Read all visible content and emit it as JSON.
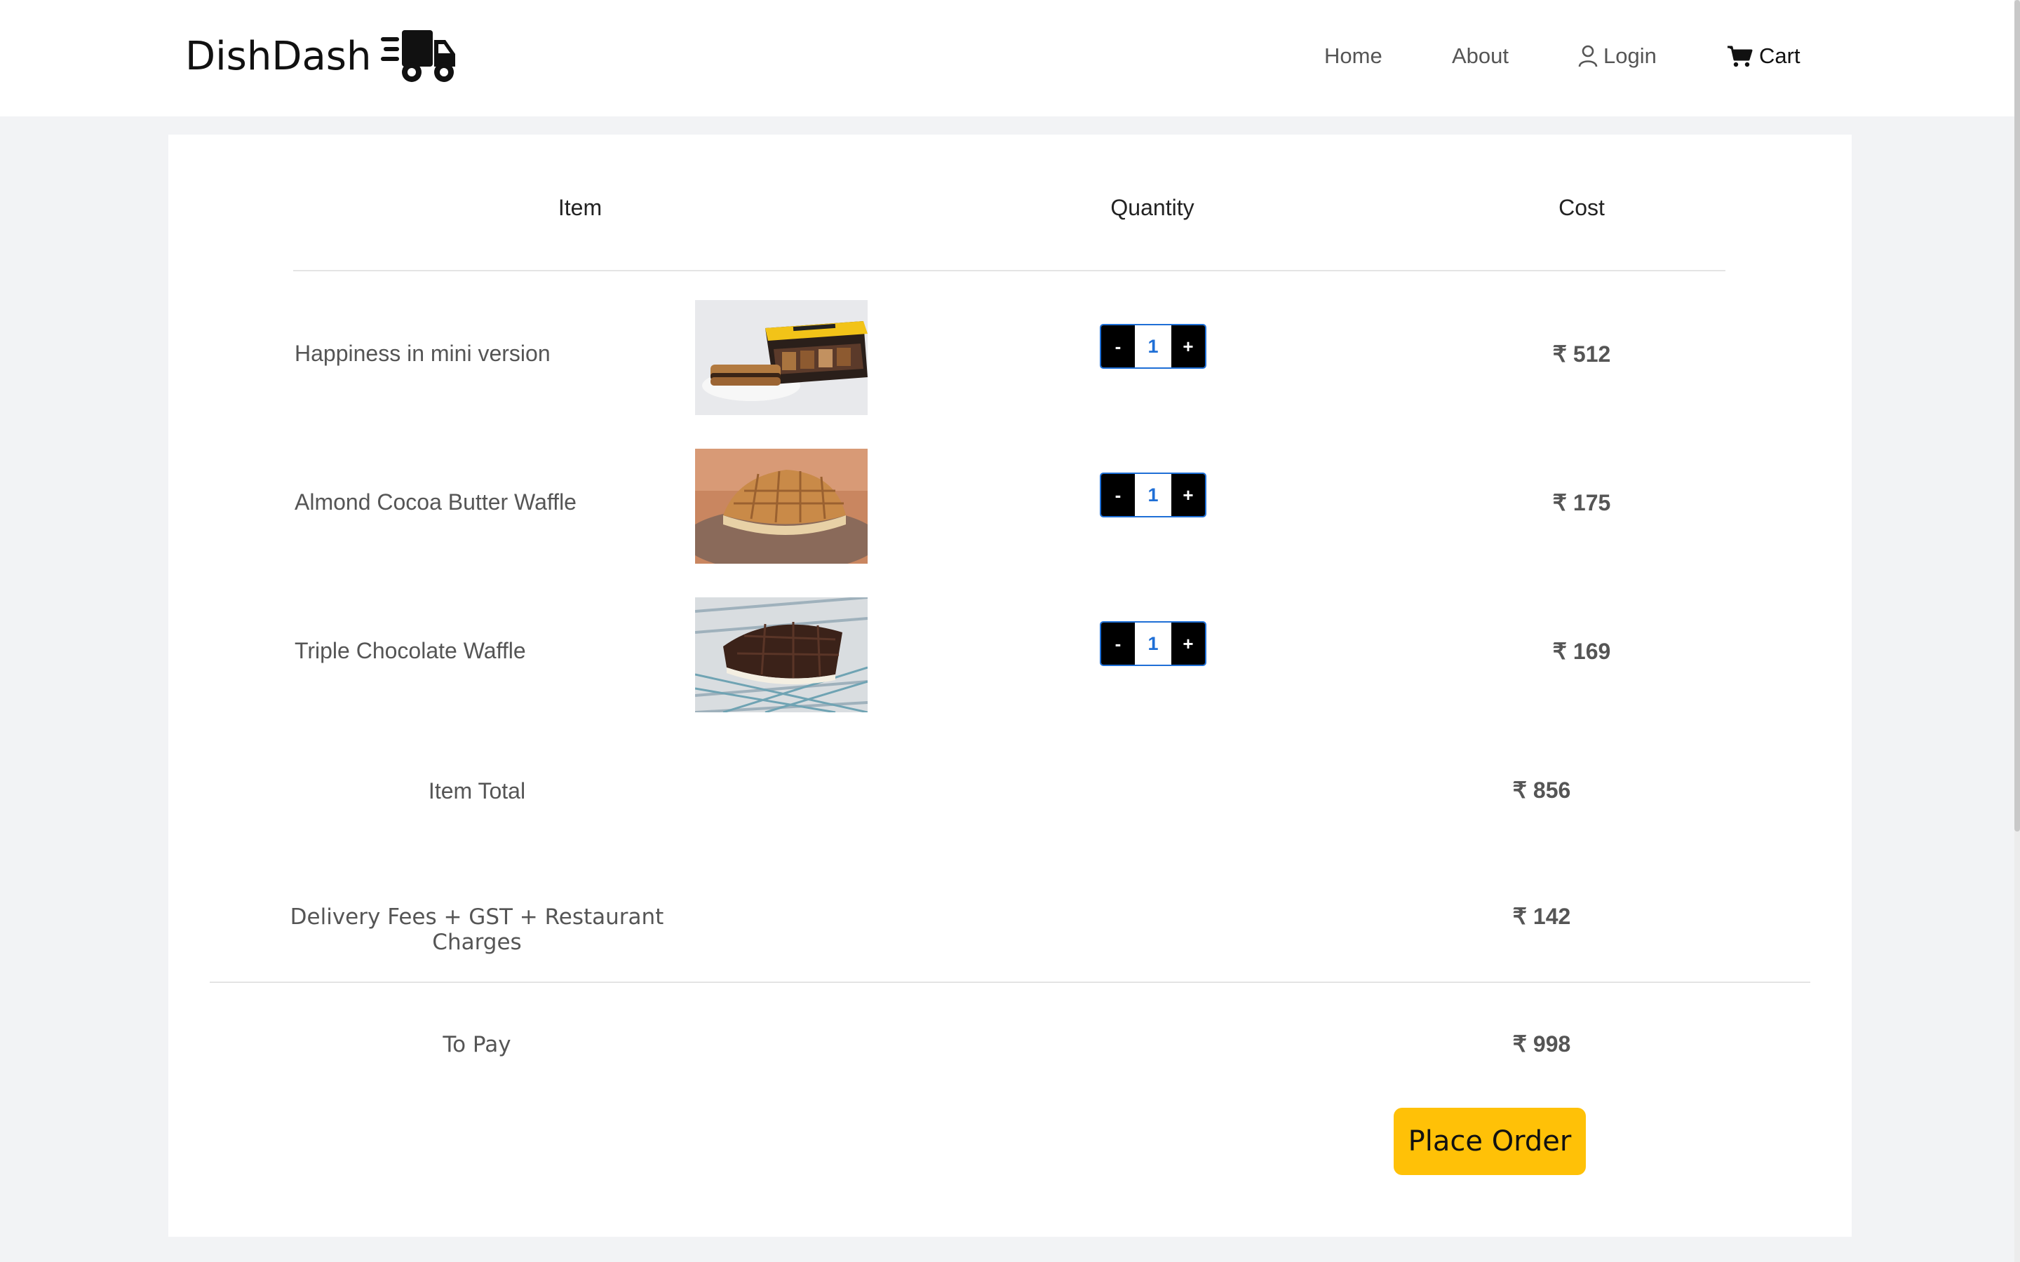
{
  "brand": {
    "name": "DishDash",
    "icon": "delivery-truck-icon"
  },
  "nav": {
    "home": "Home",
    "about": "About",
    "login": "Login",
    "cart": "Cart"
  },
  "cart": {
    "headers": {
      "item": "Item",
      "quantity": "Quantity",
      "cost": "Cost"
    },
    "items": [
      {
        "name": "Happiness in mini version",
        "quantity": "1",
        "cost": "₹ 512",
        "image": "waffle-box-image"
      },
      {
        "name": "Almond Cocoa Butter Waffle",
        "quantity": "1",
        "cost": "₹ 175",
        "image": "almond-waffle-image"
      },
      {
        "name": "Triple Chocolate Waffle",
        "quantity": "1",
        "cost": "₹ 169",
        "image": "chocolate-waffle-image"
      }
    ],
    "decrement_label": "-",
    "increment_label": "+"
  },
  "summary": {
    "item_total_label": "Item Total",
    "item_total_value": "₹ 856",
    "charges_label": "Delivery Fees + GST + Restaurant Charges",
    "charges_value": "₹ 142",
    "to_pay_label": "To Pay",
    "to_pay_value": "₹ 998"
  },
  "actions": {
    "place_order": "Place Order"
  },
  "colors": {
    "accent": "#ffc107",
    "qty_border": "#1f6fd6",
    "page_bg": "#f2f3f5"
  }
}
